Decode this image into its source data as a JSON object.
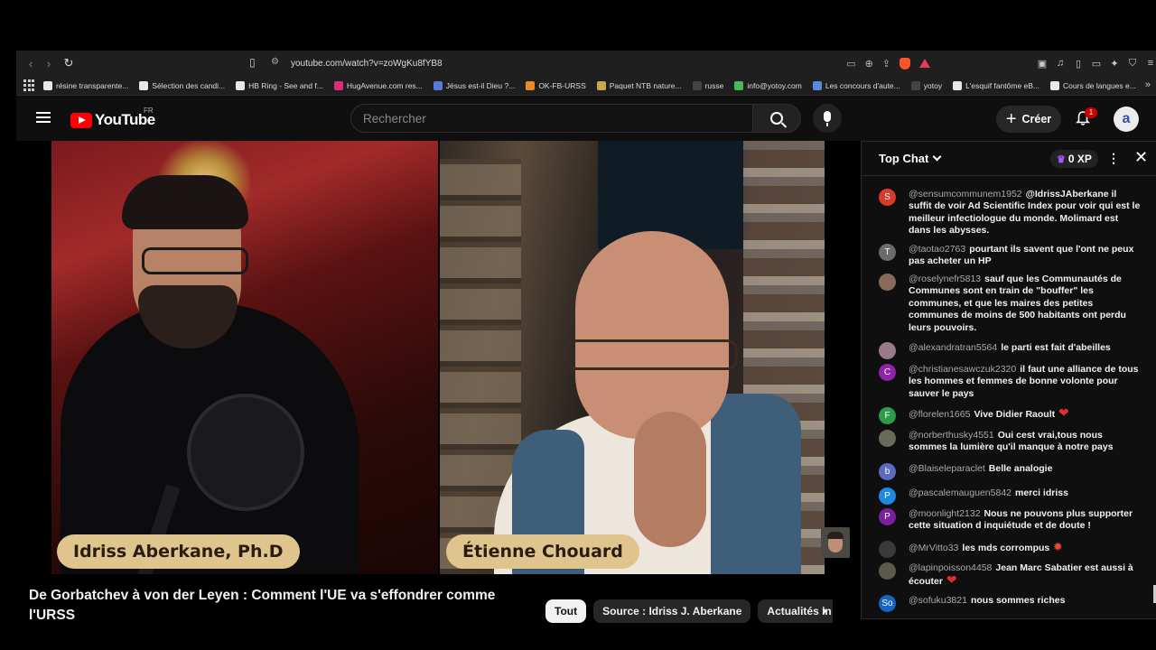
{
  "browser": {
    "url": "youtube.com/watch?v=zoWgKu8fYB8",
    "bookmarks": [
      {
        "label": "résine transparente...",
        "color": "#e8e8e8"
      },
      {
        "label": "Sélection des candi...",
        "color": "#e8e8e8"
      },
      {
        "label": "HB Ring - See and f...",
        "color": "#e8e8e8"
      },
      {
        "label": "HugAvenue.com res...",
        "color": "#d92d7a"
      },
      {
        "label": "Jésus est-il Dieu ?...",
        "color": "#5a7ad8"
      },
      {
        "label": "OK-FB-URSS",
        "color": "#e88a2a"
      },
      {
        "label": "Paquet NTB nature...",
        "color": "#c8a84a"
      },
      {
        "label": "russe",
        "color": "#444444"
      },
      {
        "label": "info@yotoy.com",
        "color": "#48b85a"
      },
      {
        "label": "Les concours d'aute...",
        "color": "#5a8ad8"
      },
      {
        "label": "yotoy",
        "color": "#444444"
      },
      {
        "label": "L'esquif fantôme eB...",
        "color": "#e8e8e8"
      },
      {
        "label": "Cours de langues e...",
        "color": "#e8e8e8"
      }
    ]
  },
  "header": {
    "logo_text": "YouTube",
    "country": "FR",
    "search_placeholder": "Rechercher",
    "create_label": "Créer",
    "notification_count": "1",
    "avatar_letter": "a"
  },
  "video": {
    "name_left": "Idriss Aberkane, Ph.D",
    "name_right": "Étienne Chouard",
    "title": "De Gorbatchev à von der Leyen : Comment l'UE va s'effondrer comme l'URSS"
  },
  "chips": [
    "Tout",
    "Source : Idriss J. Aberkane",
    "Actualités in"
  ],
  "chat": {
    "mode": "Top Chat",
    "xp": "0 XP",
    "messages": [
      {
        "author": "@sensumcommunem1952",
        "text": "@IdrissJAberkane il suffit de voir Ad Scientific Index pour voir qui est le meilleur infectiologue du monde. Molimard est dans les abysses.",
        "initial": "S",
        "color": "#d93a2b"
      },
      {
        "author": "@taotao2763",
        "text": "pourtant ils savent que l'ont ne peux pas acheter un HP",
        "initial": "T",
        "color": "#6b6b6b"
      },
      {
        "author": "@roselynefr5813",
        "text": "sauf que les Communautés de Communes sont en train de \"bouffer\" les communes, et que les maires des petites communes de moins de 500 habitants ont perdu leurs pouvoirs.",
        "initial": "",
        "color": "#8a6a5a"
      },
      {
        "author": "@alexandratran5564",
        "text": "le parti est fait d'abeilles",
        "initial": "",
        "color": "#9a7a8a"
      },
      {
        "author": "@christianesawczuk2320",
        "text": "il faut une alliance de tous les hommes et femmes de bonne volonte pour sauver le pays",
        "initial": "C",
        "color": "#8e24aa"
      },
      {
        "author": "@florelen1665",
        "text": "Vive Didier Raoult",
        "initial": "F",
        "color": "#2e9a4a"
      },
      {
        "author": "@norberthusky4551",
        "text": "Oui cest vrai,tous nous sommes la lumière qu'il manque à notre pays",
        "initial": "",
        "color": "#6a6a5a"
      },
      {
        "author": "@Blaiseleparaclet",
        "text": "Belle analogie",
        "initial": "b",
        "color": "#5c6bc0"
      },
      {
        "author": "@pascalemauguen5842",
        "text": "merci idriss",
        "initial": "P",
        "color": "#1e88e5"
      },
      {
        "author": "@moonlight2132",
        "text": "Nous ne pouvons plus supporter cette situation d inquiétude et de doute !",
        "initial": "P",
        "color": "#7b1fa2"
      },
      {
        "author": "@MrVitto33",
        "text": "les mds corrompus",
        "initial": "",
        "color": "#3a3a3a"
      },
      {
        "author": "@lapinpoisson4458",
        "text": "Jean Marc Sabatier est aussi à écouter",
        "initial": "",
        "color": "#5a5a4a"
      },
      {
        "author": "@sofuku3821",
        "text": "nous sommes riches",
        "initial": "So",
        "color": "#1565c0"
      }
    ]
  }
}
